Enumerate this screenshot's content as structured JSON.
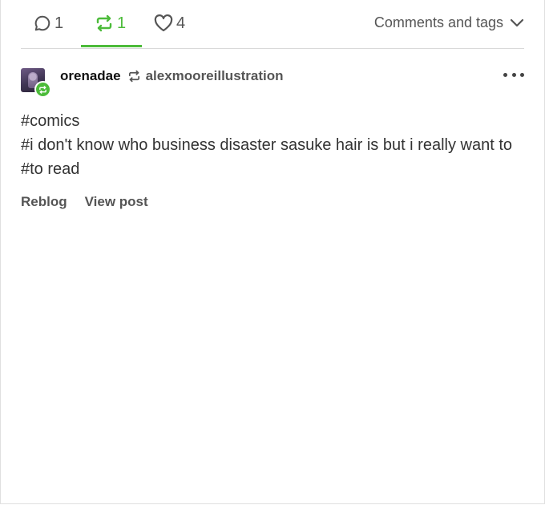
{
  "tabs": {
    "replies_count": "1",
    "reblogs_count": "1",
    "likes_count": "4",
    "active_color": "#4cbb3a"
  },
  "comments_toggle": {
    "label": "Comments and tags"
  },
  "post": {
    "blog_name": "orenadae",
    "source_blog": "alexmooreillustration",
    "tags": [
      "#comics",
      "#i don't know who business disaster sasuke hair is but i really want to",
      "#to read"
    ]
  },
  "actions": {
    "reblog_label": "Reblog",
    "view_post_label": "View post"
  },
  "icons": [
    "comment-icon",
    "reblog-icon",
    "heart-icon",
    "chevron-down-icon",
    "more-icon"
  ]
}
